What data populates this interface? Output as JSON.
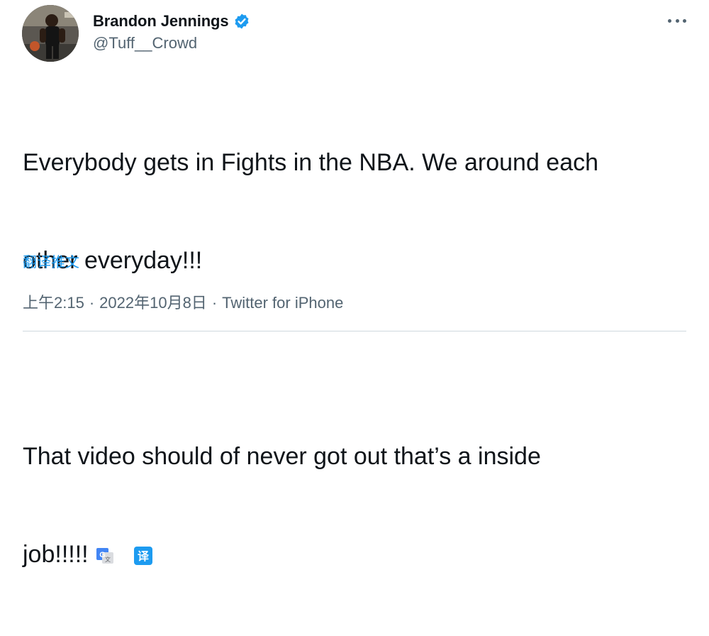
{
  "author": {
    "name": "Brandon Jennings",
    "handle": "@Tuff__Crowd",
    "verified": true,
    "verified_color": "#1d9bf0"
  },
  "tweet": {
    "lines": [
      "Everybody gets in Fights in the NBA. We around each",
      "other everyday!!!",
      "",
      "That video should of never got out that’s a inside",
      "job!!!!!"
    ]
  },
  "translate_label": "翻译推文",
  "meta": {
    "time": "上午2:15",
    "separator": "·",
    "date": "2022年10月8日",
    "source": "Twitter for iPhone"
  },
  "icons": {
    "more": "more-horizontal-icon",
    "google_translate": "google-translate-icon",
    "translate_badge": "translate-icon",
    "translate_badge_text": "译"
  },
  "colors": {
    "accent": "#1d9bf0",
    "text": "#0f1419",
    "muted": "#536471",
    "divider": "#cfd9de"
  }
}
